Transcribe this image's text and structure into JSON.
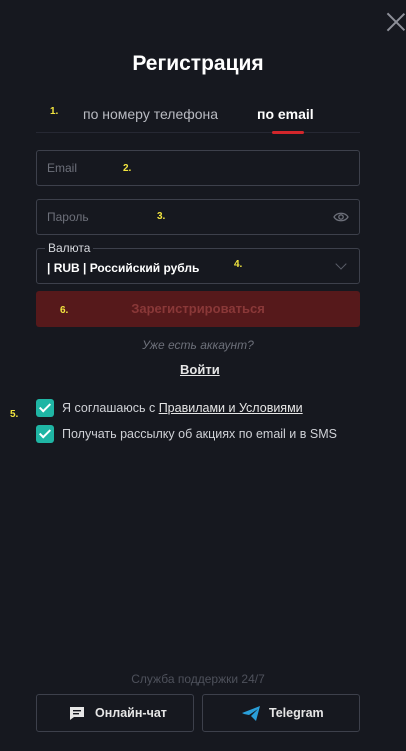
{
  "dialog": {
    "title": "Регистрация",
    "close_icon": "close-icon"
  },
  "tabs": [
    {
      "label": "по номеру телефона",
      "active": false
    },
    {
      "label": "по email",
      "active": true
    }
  ],
  "form": {
    "email": {
      "placeholder": "Email",
      "value": ""
    },
    "password": {
      "placeholder": "Пароль",
      "value": "",
      "icon": "eye-icon"
    },
    "currency": {
      "legend": "Валюта",
      "value": "| RUB | Российский рубль",
      "icon": "chevron-down-icon"
    },
    "submit_label": "Зарегистрироваться"
  },
  "login": {
    "question": "Уже есть аккаунт?",
    "link_label": "Войти"
  },
  "consents": [
    {
      "checked": true,
      "text_before": "Я соглашаюсь с ",
      "link_text": "Правилами и Условиями"
    },
    {
      "checked": true,
      "text_before": "Получать рассылку об акциях по email и в SMS",
      "link_text": ""
    }
  ],
  "markers": [
    "1.",
    "2.",
    "3.",
    "4.",
    "5.",
    "6."
  ],
  "support": {
    "title": "Служба поддержки 24/7",
    "chat_label": "Онлайн-чат",
    "telegram_label": "Telegram"
  },
  "colors": {
    "background": "#16181f",
    "accent_red": "#d2262b",
    "checkbox": "#1fb5a4",
    "telegram": "#2a9fd9",
    "marker": "#f2e53f"
  }
}
